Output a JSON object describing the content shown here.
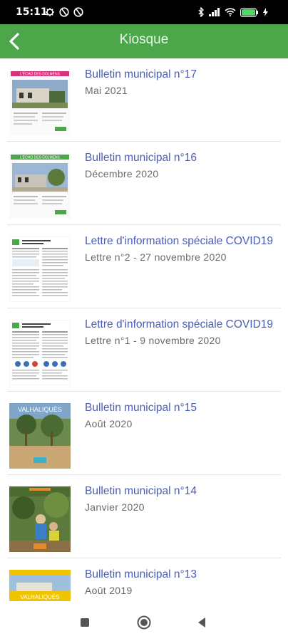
{
  "status": {
    "time": "15:11"
  },
  "header": {
    "title": "Kiosque"
  },
  "items": [
    {
      "title": "Bulletin municipal n°17",
      "subtitle": "Mai 2021",
      "cover_banner": "L'ÉCHO DES DOLMENS"
    },
    {
      "title": "Bulletin municipal n°16",
      "subtitle": "Décembre 2020",
      "cover_banner": "L'ÉCHO DES DOLMENS"
    },
    {
      "title": "Lettre d'information spéciale COVID19",
      "subtitle": "Lettre n°2 - 27 novembre 2020"
    },
    {
      "title": "Lettre d'information spéciale COVID19",
      "subtitle": "Lettre n°1 - 9 novembre 2020"
    },
    {
      "title": "Bulletin municipal n°15",
      "subtitle": "Août 2020",
      "cover_banner": "VALHALIQUÈS"
    },
    {
      "title": "Bulletin municipal n°14",
      "subtitle": "Janvier 2020"
    },
    {
      "title": "Bulletin municipal n°13",
      "subtitle": "Août 2019",
      "cover_banner": "VALHALIQUÈS"
    }
  ],
  "colors": {
    "app_bar": "#4ca74b",
    "title_link": "#4a5db6",
    "subtitle": "#6a6a6a"
  }
}
